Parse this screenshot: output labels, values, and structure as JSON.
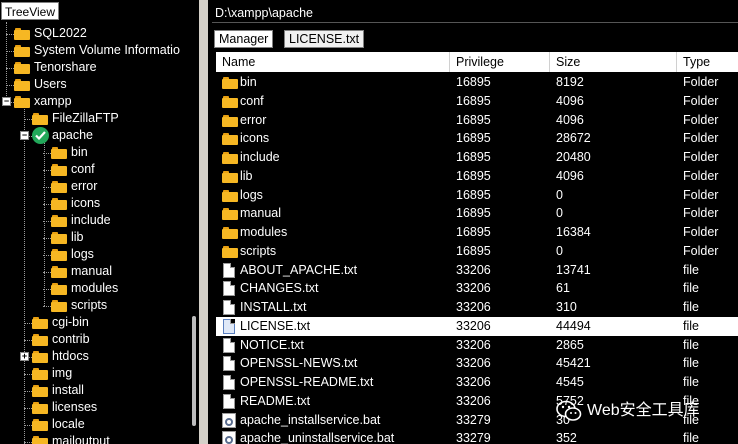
{
  "tree": {
    "tab_label": "TreeView",
    "nodes": [
      {
        "label": "SQL2022"
      },
      {
        "label": "System Volume Informatio"
      },
      {
        "label": "Tenorshare"
      },
      {
        "label": "Users"
      },
      {
        "label": "xampp",
        "expander": "−"
      },
      {
        "label": "FileZillaFTP"
      },
      {
        "label": "apache",
        "expander": "−"
      },
      {
        "label": "bin"
      },
      {
        "label": "conf"
      },
      {
        "label": "error"
      },
      {
        "label": "icons"
      },
      {
        "label": "include"
      },
      {
        "label": "lib"
      },
      {
        "label": "logs"
      },
      {
        "label": "manual"
      },
      {
        "label": "modules"
      },
      {
        "label": "scripts"
      },
      {
        "label": "cgi-bin"
      },
      {
        "label": "contrib"
      },
      {
        "label": "htdocs",
        "expander": "+"
      },
      {
        "label": "img"
      },
      {
        "label": "install"
      },
      {
        "label": "licenses"
      },
      {
        "label": "locale"
      },
      {
        "label": "mailoutput"
      }
    ]
  },
  "path": "D:\\xampp\\apache",
  "tabs": {
    "manager": "Manager",
    "license": "LICENSE.txt"
  },
  "list": {
    "columns": [
      "Name",
      "Privilege",
      "Size",
      "Type"
    ],
    "rows": [
      {
        "name": "bin",
        "privilege": "16895",
        "size": "8192",
        "type": "Folder",
        "icon": "folder-icon"
      },
      {
        "name": "conf",
        "privilege": "16895",
        "size": "4096",
        "type": "Folder",
        "icon": "folder-icon"
      },
      {
        "name": "error",
        "privilege": "16895",
        "size": "4096",
        "type": "Folder",
        "icon": "folder-icon"
      },
      {
        "name": "icons",
        "privilege": "16895",
        "size": "28672",
        "type": "Folder",
        "icon": "folder-icon"
      },
      {
        "name": "include",
        "privilege": "16895",
        "size": "20480",
        "type": "Folder",
        "icon": "folder-icon"
      },
      {
        "name": "lib",
        "privilege": "16895",
        "size": "4096",
        "type": "Folder",
        "icon": "folder-icon"
      },
      {
        "name": "logs",
        "privilege": "16895",
        "size": "0",
        "type": "Folder",
        "icon": "folder-icon"
      },
      {
        "name": "manual",
        "privilege": "16895",
        "size": "0",
        "type": "Folder",
        "icon": "folder-icon"
      },
      {
        "name": "modules",
        "privilege": "16895",
        "size": "16384",
        "type": "Folder",
        "icon": "folder-icon"
      },
      {
        "name": "scripts",
        "privilege": "16895",
        "size": "0",
        "type": "Folder",
        "icon": "folder-icon"
      },
      {
        "name": "ABOUT_APACHE.txt",
        "privilege": "33206",
        "size": "13741",
        "type": "file",
        "icon": "file-icon"
      },
      {
        "name": "CHANGES.txt",
        "privilege": "33206",
        "size": "61",
        "type": "file",
        "icon": "file-icon"
      },
      {
        "name": "INSTALL.txt",
        "privilege": "33206",
        "size": "310",
        "type": "file",
        "icon": "file-icon"
      },
      {
        "name": "LICENSE.txt",
        "privilege": "33206",
        "size": "44494",
        "type": "file",
        "icon": "file-icon",
        "selected": true
      },
      {
        "name": "NOTICE.txt",
        "privilege": "33206",
        "size": "2865",
        "type": "file",
        "icon": "file-icon"
      },
      {
        "name": "OPENSSL-NEWS.txt",
        "privilege": "33206",
        "size": "45421",
        "type": "file",
        "icon": "file-icon"
      },
      {
        "name": "OPENSSL-README.txt",
        "privilege": "33206",
        "size": "4545",
        "type": "file",
        "icon": "file-icon"
      },
      {
        "name": "README.txt",
        "privilege": "33206",
        "size": "5752",
        "type": "file",
        "icon": "file-icon"
      },
      {
        "name": "apache_installservice.bat",
        "privilege": "33279",
        "size": "30",
        "type": "file",
        "icon": "bat-file-icon"
      },
      {
        "name": "apache_uninstallservice.bat",
        "privilege": "33279",
        "size": "352",
        "type": "file",
        "icon": "bat-file-icon"
      }
    ]
  },
  "watermark": {
    "text": "Web安全工具库"
  },
  "colors": {
    "background": "#000000",
    "folder": "#f6b723",
    "check": "#22a85a",
    "selected_row": "#ffffff"
  }
}
